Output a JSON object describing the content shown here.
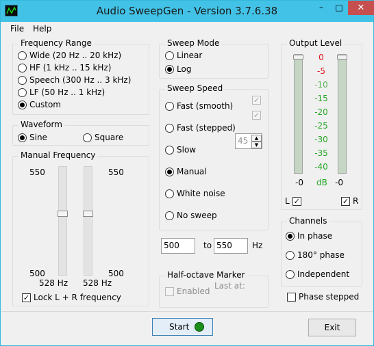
{
  "window": {
    "title": "Audio SweepGen - Version 3.7.6.38",
    "minimize": "–",
    "maximize": "□",
    "close": "✕"
  },
  "menu": {
    "file": "File",
    "help": "Help"
  },
  "frequency_range": {
    "title": "Frequency Range",
    "options": [
      {
        "label": "Wide  (20 Hz .. 20 kHz)",
        "selected": false
      },
      {
        "label": "HF  (1 kHz .. 15 kHz)",
        "selected": false
      },
      {
        "label": "Speech  (300 Hz .. 3 kHz)",
        "selected": false
      },
      {
        "label": "LF  (50 Hz .. 1 kHz)",
        "selected": false
      },
      {
        "label": "Custom",
        "selected": true
      }
    ]
  },
  "waveform": {
    "title": "Waveform",
    "sine": "Sine",
    "square": "Square",
    "selected": "Sine"
  },
  "manual_frequency": {
    "title": "Manual Frequency",
    "left_top": "550",
    "right_top": "550",
    "left_bottom": "500",
    "right_bottom": "500",
    "left_value": "528 Hz",
    "right_value": "528 Hz",
    "lock_label": "Lock L + R frequency",
    "lock_checked": true
  },
  "sweep_mode": {
    "title": "Sweep Mode",
    "linear": "Linear",
    "log": "Log",
    "selected": "Log"
  },
  "sweep_speed": {
    "title": "Sweep Speed",
    "fast_smooth": "Fast (smooth)",
    "fast_stepped": "Fast (stepped)",
    "slow": "Slow",
    "manual": "Manual",
    "white_noise": "White noise",
    "no_sweep": "No sweep",
    "selected": "Manual",
    "step_value": "45"
  },
  "range": {
    "from": "500",
    "to_label": "to",
    "to": "550",
    "unit": "Hz"
  },
  "half_octave": {
    "title": "Half-octave Marker",
    "last_at": "Last at:",
    "enabled": "Enabled"
  },
  "output_level": {
    "title": "Output Level",
    "scale": [
      "0",
      "-5",
      "-10",
      "-15",
      "-20",
      "-25",
      "-30",
      "-35",
      "-40"
    ],
    "scale_colors": [
      "#e0141b",
      "#e0141b",
      "#5bb55b",
      "#24a524",
      "#24a524",
      "#24a524",
      "#24a524",
      "#24a524",
      "#24a524"
    ],
    "left_reading": "-0",
    "unit": "dB",
    "right_reading": "-0",
    "left_label": "L",
    "right_label": "R",
    "left_checked": true,
    "right_checked": true
  },
  "channels": {
    "title": "Channels",
    "in_phase": "In phase",
    "deg180": "180° phase",
    "independent": "Independent",
    "selected": "In phase",
    "phase_stepped": "Phase stepped"
  },
  "buttons": {
    "start": "Start",
    "exit": "Exit"
  }
}
